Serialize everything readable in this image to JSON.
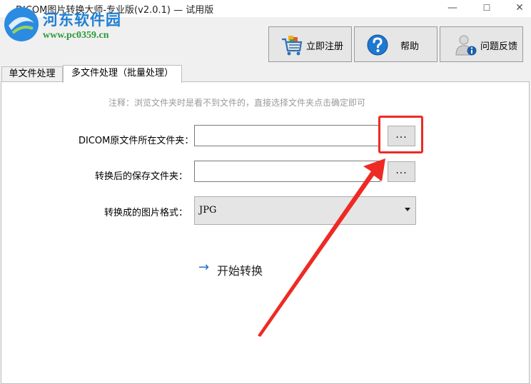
{
  "window": {
    "title": "DICOM图片转换大师-专业版(v2.0.1) — 试用版",
    "min_glyph": "—",
    "max_glyph": "☐",
    "close_glyph": "✕"
  },
  "watermark": {
    "site_name": "河东软件园",
    "url": "www.pc0359.cn"
  },
  "toolbar": {
    "register_label": "立即注册",
    "help_label": "帮助",
    "feedback_label": "问题反馈"
  },
  "tabs": [
    {
      "label": "单文件处理",
      "active": false
    },
    {
      "label": "多文件处理（批量处理）",
      "active": true
    }
  ],
  "form": {
    "note": "注释：浏览文件夹时是看不到文件的，直接选择文件夹点击确定即可",
    "source_folder_label": "DICOM原文件所在文件夹：",
    "source_folder_value": "",
    "output_folder_label": "转换后的保存文件夹：",
    "output_folder_value": "",
    "browse_label": "...",
    "format_label": "转换成的图片格式：",
    "format_value": "JPG",
    "convert_label": "开始转换",
    "convert_arrow": "→"
  },
  "colors": {
    "annotation_red": "#ee2a24",
    "accent_blue": "#1e73c8"
  }
}
